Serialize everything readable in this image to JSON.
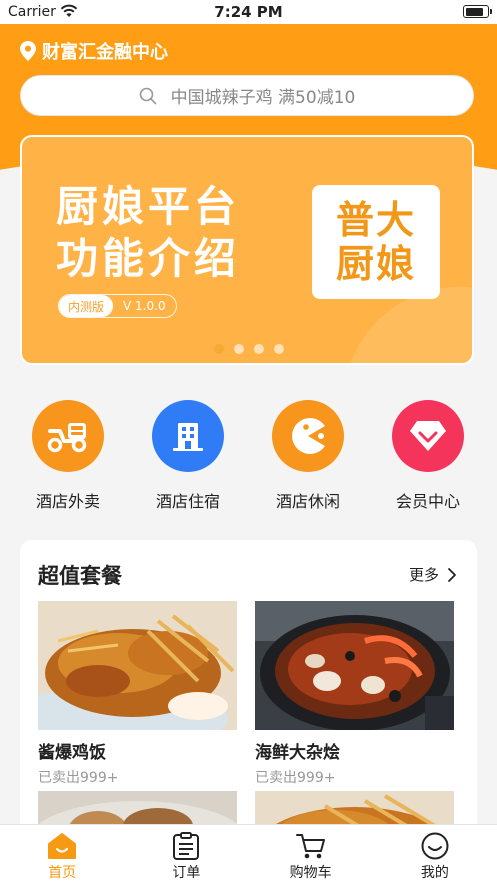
{
  "status_bar": {
    "carrier": "Carrier",
    "time": "7:24 PM"
  },
  "location": {
    "name": "财富汇金融中心",
    "icon": "location-pin-icon"
  },
  "search": {
    "placeholder": "中国城辣子鸡 满50减10",
    "icon": "search-icon"
  },
  "banner": {
    "title_line1": "厨娘平台",
    "title_line2": "功能介绍",
    "tag": "内测版",
    "version": "V 1.0.0",
    "logo_line1": "普大",
    "logo_line2": "厨娘",
    "dots": 4,
    "active_dot": 0
  },
  "categories": [
    {
      "label": "酒店外卖",
      "icon": "delivery-scooter-icon",
      "color": "#f8951d"
    },
    {
      "label": "酒店住宿",
      "icon": "hotel-building-icon",
      "color": "#2f7cf6"
    },
    {
      "label": "酒店休闲",
      "icon": "pacman-icon",
      "color": "#f8951d"
    },
    {
      "label": "会员中心",
      "icon": "diamond-icon",
      "color": "#f4345a"
    }
  ],
  "section": {
    "title": "超值套餐",
    "more": "更多",
    "items": [
      {
        "name": "酱爆鸡饭",
        "sold": "已卖出999+"
      },
      {
        "name": "海鲜大杂烩",
        "sold": "已卖出999+"
      }
    ]
  },
  "tabbar": [
    {
      "label": "首页",
      "icon": "home-icon",
      "active": true
    },
    {
      "label": "订单",
      "icon": "order-clipboard-icon",
      "active": false
    },
    {
      "label": "购物车",
      "icon": "shopping-cart-icon",
      "active": false
    },
    {
      "label": "我的",
      "icon": "smiley-profile-icon",
      "active": false
    }
  ],
  "colors": {
    "accent": "#ff9d14",
    "active_tab": "#f59a12"
  }
}
